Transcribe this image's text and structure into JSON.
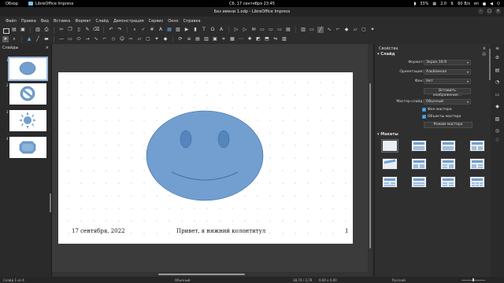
{
  "topbar": {
    "activities": "Обзор",
    "app_name": "LibreOffice Impress",
    "clock": "Сб, 17 сентября  23:45",
    "battery": "33%",
    "cpu": "2.0",
    "net": "60 B/s",
    "lang": "en"
  },
  "window": {
    "title": "Без имени 1.odp - LibreOffice Impress"
  },
  "menu": [
    "Файл",
    "Правка",
    "Вид",
    "Вставка",
    "Формат",
    "Слайд",
    "Демонстрация",
    "Сервис",
    "Окно",
    "Справка"
  ],
  "slides_panel": {
    "title": "Слайды",
    "numbers": [
      "1",
      "2",
      "3",
      "4"
    ]
  },
  "footer": {
    "date": "17 сентября, 2022",
    "text": "Привет, я нижний колонтитул",
    "number": "1"
  },
  "properties": {
    "title": "Свойства",
    "section_slide": "Слайд",
    "format_label": "Формат:",
    "format_value": "Экран 16:9",
    "orientation_label": "Ориентация:",
    "orientation_value": "Альбомная",
    "background_label": "Фон:",
    "background_value": "Нет",
    "insert_image": "Вставить изображение...",
    "master_label": "Мастер-слайд:",
    "master_value": "Обычный",
    "master_background": "Фон мастера",
    "master_objects": "Объекты мастера",
    "master_mode": "Режим мастера",
    "section_layouts": "Макеты"
  },
  "status": {
    "slide": "Слайд 1 из 4",
    "master": "Обычный",
    "position": "38,74 / 3,79",
    "size": "0,00 x 0,00",
    "language": "Русский"
  },
  "colors": {
    "smile_fill": "#729fcf",
    "smile_stroke": "#3465a4",
    "accent": "#3d8fd8"
  }
}
